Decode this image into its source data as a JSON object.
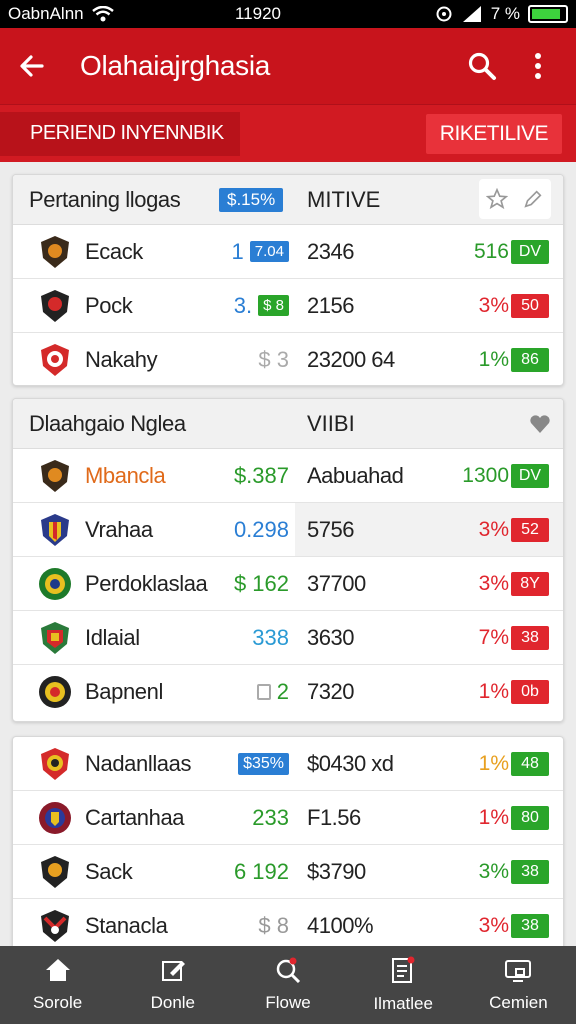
{
  "status": {
    "carrier": "OabnAlnn",
    "time": "11920",
    "battery": "7 %"
  },
  "appbar": {
    "title": "Olahaiajrghasia"
  },
  "banner": {
    "tag": "PERIEND INYENNBIK",
    "live": "RIKETILIVE"
  },
  "colors": {
    "red": "#c8141c",
    "green": "#2a9a2a",
    "blue": "#2a7ed4",
    "chip_green": "#2aa52a",
    "chip_red": "#e0262e"
  },
  "card1": {
    "header": {
      "name": "Pertaning llogas",
      "badge": "$.15%",
      "col2": "MITIVE"
    },
    "rows": [
      {
        "team": "Ecack",
        "val": "1",
        "val_badge": "7.04",
        "num": "2346",
        "pct": "516",
        "chip": "DV"
      },
      {
        "team": "Pock",
        "val": "3.",
        "val_badge": "$ 8",
        "num": "2156",
        "pct": "3%",
        "chip": "50"
      },
      {
        "team": "Nakahy",
        "val": "$ 3",
        "num": "23200 64",
        "pct": "1%",
        "chip": "86"
      }
    ]
  },
  "card2": {
    "header": {
      "name": "Dlaahgaio Nglea",
      "col2": "VIIBI"
    },
    "rows": [
      {
        "team": "Mbancla",
        "val": "$.387",
        "num": "Aabuahad",
        "pct": "1300",
        "chip": "DV"
      },
      {
        "team": "Vrahaa",
        "val": "0.298",
        "num": "5756",
        "pct": "3%",
        "chip": "52"
      },
      {
        "team": "Perdoklaslaa",
        "val": "$ 162",
        "num": "37700",
        "pct": "3%",
        "chip": "8Y"
      },
      {
        "team": "Idlaial",
        "val": "338",
        "num": "3630",
        "pct": "7%",
        "chip": "38"
      },
      {
        "team": "Bapnenl",
        "val": "2",
        "num": "7320",
        "pct": "1%",
        "chip": "0b"
      }
    ]
  },
  "card3": {
    "rows": [
      {
        "team": "Nadanllaas",
        "val_badge": "$35%",
        "num": "$0430 xd",
        "pct": "1%",
        "chip": "48"
      },
      {
        "team": "Cartanhaa",
        "val": "233",
        "num": "F1.56",
        "pct": "1%",
        "chip": "80"
      },
      {
        "team": "Sack",
        "val": "6 192",
        "num": "$3790",
        "pct": "3%",
        "chip": "38"
      },
      {
        "team": "Stanacla",
        "val": "$ 8",
        "num": "4100%",
        "pct": "3%",
        "chip": "38"
      }
    ]
  },
  "nav": [
    {
      "label": "Sorole",
      "icon": "home-icon"
    },
    {
      "label": "Donle",
      "icon": "edit-icon"
    },
    {
      "label": "Flowe",
      "icon": "search-icon"
    },
    {
      "label": "Ilmatlee",
      "icon": "document-icon"
    },
    {
      "label": "Cemien",
      "icon": "screen-icon"
    }
  ]
}
